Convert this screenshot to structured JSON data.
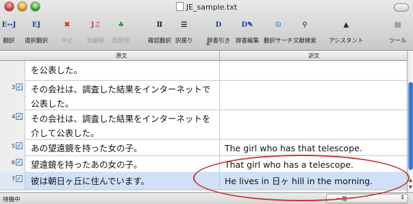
{
  "window": {
    "title": "JE_sample.txt"
  },
  "toolbar": {
    "items": [
      {
        "label": "翻訳",
        "icon": "ej-translate-icon",
        "glyph": "E↔J",
        "color": "#1a3f8f"
      },
      {
        "label": "選択翻訳",
        "icon": "ej-selection-translate-icon",
        "glyph": "EJ",
        "color": "#1a3f8f"
      },
      {
        "label": "中止",
        "icon": "stop-x-icon",
        "glyph": "✖",
        "color": "#d22f2f"
      },
      {
        "label": "別解析",
        "icon": "alternative-parse-icon",
        "glyph": "J♫",
        "color": "#b23a8a"
      },
      {
        "label": "別訳語",
        "icon": "alternative-word-icon",
        "glyph": "♣",
        "color": "#3c8f3c"
      },
      {
        "label": "確認翻訳",
        "icon": "columns-icon",
        "glyph": "Ⅱ",
        "color": "#222222"
      },
      {
        "label": "訳振り",
        "icon": "lines-icon",
        "glyph": "☰",
        "color": "#222222"
      },
      {
        "label": "辞書引き",
        "icon": "dictionary-lookup-icon",
        "glyph": "D",
        "color": "#1d3fb5"
      },
      {
        "label": "辞書編集",
        "icon": "dictionary-edit-icon",
        "glyph": "D✎",
        "color": "#1d3fb5"
      },
      {
        "label": "翻訳サーチ",
        "icon": "translation-search-icon",
        "glyph": "☉",
        "color": "#2d6ea8"
      },
      {
        "label": "文献検索",
        "icon": "magnifier-icon",
        "glyph": "⚲",
        "color": "#555555"
      },
      {
        "label": "アシスタント",
        "icon": "assistant-icon",
        "glyph": "▲",
        "color": "#222222"
      },
      {
        "label": "ツール",
        "icon": "tool-icon",
        "glyph": "▤",
        "color": "#555555"
      }
    ]
  },
  "columns": {
    "source": "原文",
    "target": "訳文"
  },
  "rows": [
    {
      "num": "",
      "source": "を公表した。",
      "target": "",
      "checked": false
    },
    {
      "num": "3",
      "source": "その会社は、調査した結果をインターネットで公表した。",
      "target": "",
      "checked": true
    },
    {
      "num": "4",
      "source": "その会社は、調査した結果をインターネットを介して公表した。",
      "target": "",
      "checked": true
    },
    {
      "num": "5",
      "source": "あの望遠鏡を持った女の子。",
      "target": "The girl who has that telescope.",
      "checked": true
    },
    {
      "num": "6",
      "source": "望遠鏡を持ったあの女の子。",
      "target": "That girl who has a telescope.",
      "checked": true
    },
    {
      "num": "7",
      "source": "彼は朝日ヶ丘に住んでいます。",
      "target": "He lives in 日ヶ hill in the morning.",
      "checked": true
    }
  ],
  "status": {
    "text": "待機中",
    "mode": "一般"
  },
  "colors": {
    "selection": "#cfe0f7",
    "annotation": "#c8362f"
  }
}
